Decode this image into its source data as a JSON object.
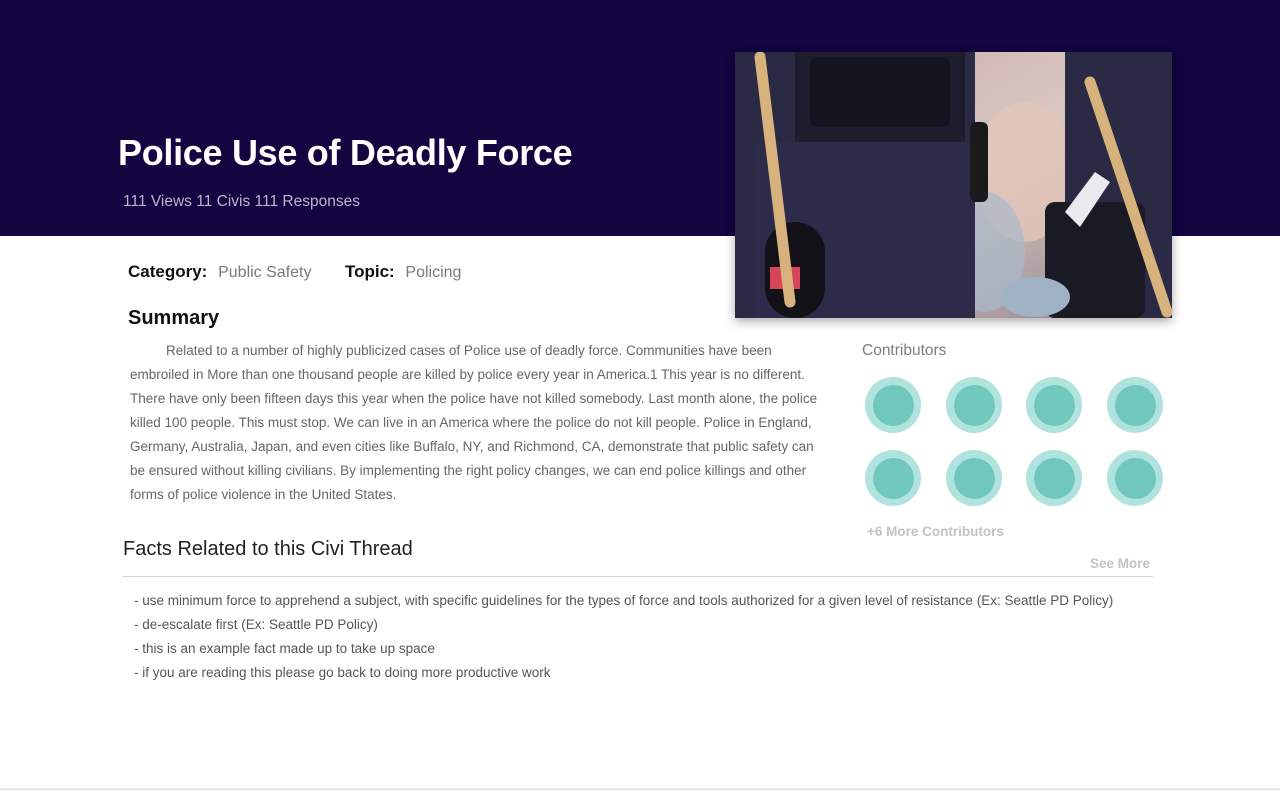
{
  "thread": {
    "title": "Police Use of Deadly Force",
    "stats": {
      "views": "111 Views",
      "civis": "11 Civis",
      "responses": "111 Responses"
    },
    "category_label": "Category:",
    "category_value": "Public Safety",
    "topic_label": "Topic:",
    "topic_value": "Policing"
  },
  "summary": {
    "heading": "Summary",
    "body": "Related to a number of highly publicized cases of Police use of deadly force. Communities have been embroiled in More than one thousand people are killed by police every year in America.1 This year is no different. There have only been fifteen days this year when the police have not killed somebody. Last month alone, the police killed 100 people. This must stop. We can live in an America where the police do not kill people. Police in England, Germany, Australia, Japan, and even cities like Buffalo, NY, and Richmond, CA, demonstrate that public safety can be ensured without killing civilians. By implementing the right policy changes, we can end police killings and other forms of police violence in the United States."
  },
  "contributors": {
    "heading": "Contributors",
    "count_shown": 8,
    "more_label": "+6 More Contributors"
  },
  "facts": {
    "heading": "Facts Related to this Civi Thread",
    "see_more": "See More",
    "items": [
      "- use minimum force to apprehend a subject, with specific guidelines for the types of force and tools authorized for a given level of resistance (Ex: Seattle PD Policy)",
      "- de-escalate first (Ex: Seattle PD Policy)",
      "- this is an example fact made up to take up space",
      "- if you are reading this please go back to doing more productive work"
    ]
  },
  "colors": {
    "header_bg": "#120540",
    "avatar_outer": "#b0e3dd",
    "avatar_inner": "#70c8bd"
  }
}
